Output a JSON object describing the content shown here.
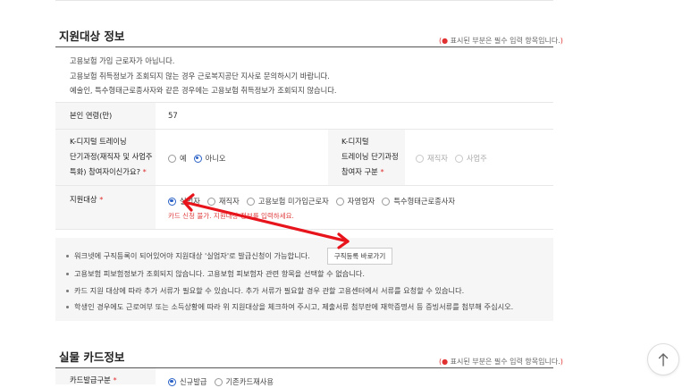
{
  "section1": {
    "title": "지원대상 정보",
    "required_note": {
      "open": "(",
      "dot": "●",
      "text": " 표시된 부분은 필수 입력 항목입니다.",
      "close": ")"
    },
    "info_lines": [
      "고용보험 가입 근로자가 아닙니다.",
      "고용보험 취득정보가 조회되지 않는 경우 근로복지공단 지사로 문의하시기 바랍니다.",
      "예술인, 특수형태근로종사자와 같은 경우에는 고용보험 취득정보가 조회되지 않습니다."
    ],
    "age": {
      "label": "본인 연령(만)",
      "value": "57"
    },
    "kdigital": {
      "label_lines": [
        "K-디지털 트레이닝",
        "단기과정(재직자 및 사업주",
        "특화) 참여자이신가요?"
      ],
      "star": "*",
      "options": [
        "예",
        "아니오"
      ],
      "selected": "아니오"
    },
    "kdigital_type": {
      "label_lines": [
        "K-디지털",
        "트레이닝 단기과정",
        "참여자 구분"
      ],
      "star": "*",
      "options": [
        "재직자",
        "사업주"
      ]
    },
    "target": {
      "label": "지원대상",
      "star": "*",
      "options": [
        "실업자",
        "재직자",
        "고용보험 미가입근로자",
        "자영업자",
        "특수형태근로종사자"
      ],
      "selected": "실업자",
      "error": "카드 신청 불가. 지원대상 정보를 입력하세요."
    },
    "notices": [
      "워크넷에 구직등록이 되어있어야 지원대상 '실업자'로 발급신청이 가능합니다.",
      "고용보험 피보험정보가 조회되지 않습니다. 고용보험 피보험자 관련 항목을 선택할 수 없습니다.",
      "카드 지원 대상에 따라 추가 서류가 필요할 수 있습니다. 추가 서류가 필요할 경우 관할 고용센터에서 서류를 요청할 수 있습니다.",
      "학생인 경우에도 근로여부 또는 소득상황에 따라 위 지원대상을 체크하여 주시고, 제출서류 첨부란에 재학증명서 등 증빙서류를 첨부해 주십시오."
    ],
    "job_register_button": "구직등록 바로가기"
  },
  "section2": {
    "title": "실물 카드정보",
    "required_note": {
      "open": "(",
      "dot": "●",
      "text": " 표시된 부분은 필수 입력 항목입니다.",
      "close": ")"
    },
    "card_issue": {
      "label": "카드발급구분",
      "star": "*",
      "options": [
        "신규발급",
        "기존카드재사용"
      ],
      "selected": "신규발급"
    }
  },
  "annotation": {
    "arrow_color": "#e8141c"
  },
  "scroll_top_icon": "arrow-up-icon"
}
